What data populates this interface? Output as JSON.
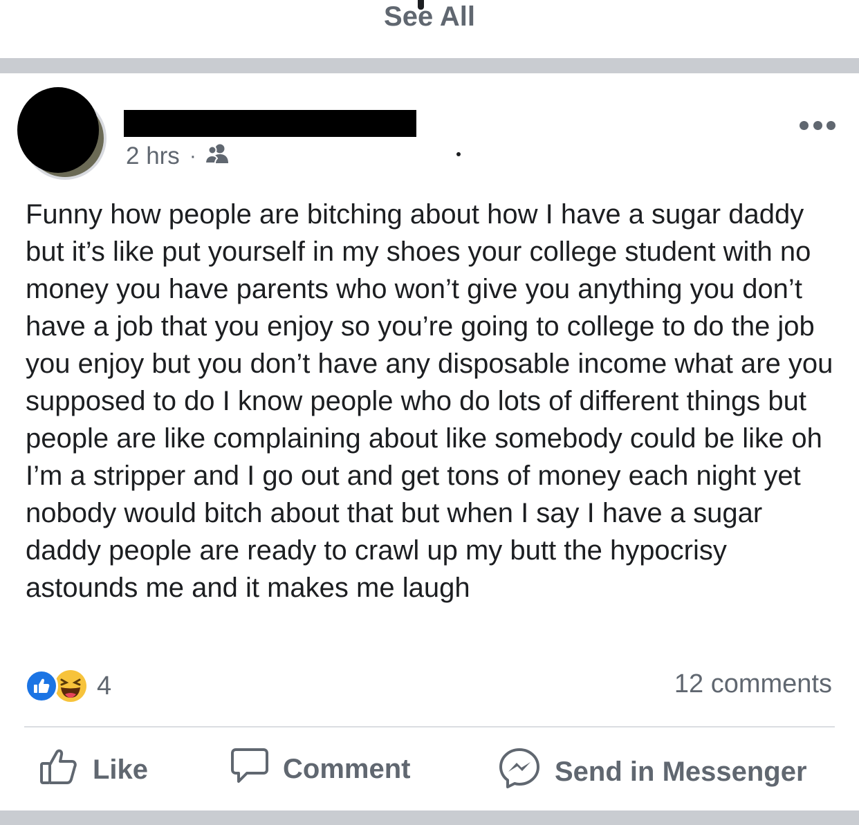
{
  "top": {
    "see_all_label": "See All"
  },
  "post": {
    "author": {
      "name": "",
      "avatar": "avatar-redacted"
    },
    "time": "2 hrs",
    "privacy_icon": "friends-icon",
    "body": "Funny how people are bitching about how I have a sugar daddy but it’s like put yourself in my shoes your college student with no money you have parents who won’t give you anything you don’t have a job that you enjoy so you’re going to college to do the job you enjoy but you don’t have any disposable income what are you supposed to do I know people who do lots of different things but people are like complaining about like somebody could be like oh I’m a stripper and I go out and get tons of money each night yet nobody would bitch about that but when I say I have a sugar daddy people are ready to crawl up my butt the hypocrisy astounds me and it makes me laugh",
    "reactions": {
      "types": [
        "like",
        "haha"
      ],
      "count": "4"
    },
    "comments_label": "12 comments"
  },
  "actions": {
    "like_label": "Like",
    "comment_label": "Comment",
    "messenger_label": "Send in Messenger"
  },
  "colors": {
    "secondary_text": "#606770",
    "primary_text": "#1c1e21",
    "like_blue": "#1b74e4",
    "haha_yellow": "#f7c33b",
    "divider_band": "#c9ccd1"
  }
}
